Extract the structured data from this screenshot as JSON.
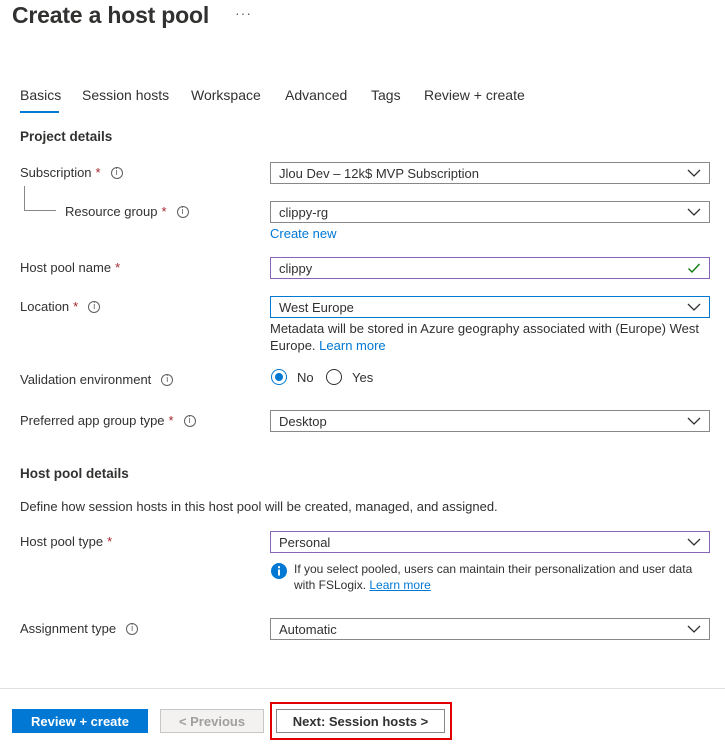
{
  "header": {
    "title": "Create a host pool",
    "more_label": "···"
  },
  "tabs": [
    {
      "label": "Basics",
      "active": true
    },
    {
      "label": "Session hosts"
    },
    {
      "label": "Workspace"
    },
    {
      "label": "Advanced"
    },
    {
      "label": "Tags"
    },
    {
      "label": "Review + create"
    }
  ],
  "project_details": {
    "heading": "Project details",
    "subscription": {
      "label": "Subscription",
      "required": "*",
      "value": "Jlou Dev – 12k$ MVP Subscription"
    },
    "resource_group": {
      "label": "Resource group",
      "required": "*",
      "value": "clippy-rg",
      "create_new": "Create new"
    },
    "host_pool_name": {
      "label": "Host pool name",
      "required": "*",
      "value": "clippy"
    },
    "location": {
      "label": "Location",
      "required": "*",
      "value": "West Europe",
      "help_text": "Metadata will be stored in Azure geography associated with (Europe) West Europe.",
      "learn_more": "Learn more"
    },
    "validation_environment": {
      "label": "Validation environment",
      "options": [
        {
          "label": "No",
          "selected": true
        },
        {
          "label": "Yes",
          "selected": false
        }
      ]
    },
    "preferred_app_group_type": {
      "label": "Preferred app group type",
      "required": "*",
      "value": "Desktop"
    }
  },
  "host_pool_details": {
    "heading": "Host pool details",
    "description": "Define how session hosts in this host pool will be created, managed, and assigned.",
    "host_pool_type": {
      "label": "Host pool type",
      "required": "*",
      "value": "Personal",
      "info_text": "If you select pooled, users can maintain their personalization and user data with FSLogix.",
      "learn_more": "Learn more"
    },
    "assignment_type": {
      "label": "Assignment type",
      "value": "Automatic"
    }
  },
  "footer": {
    "review_create": "Review + create",
    "previous": "< Previous",
    "next": "Next: Session hosts >"
  },
  "colors": {
    "accent": "#0078d4",
    "required": "#a4262c",
    "valid_check": "#107c10",
    "highlight": "#e00000"
  }
}
